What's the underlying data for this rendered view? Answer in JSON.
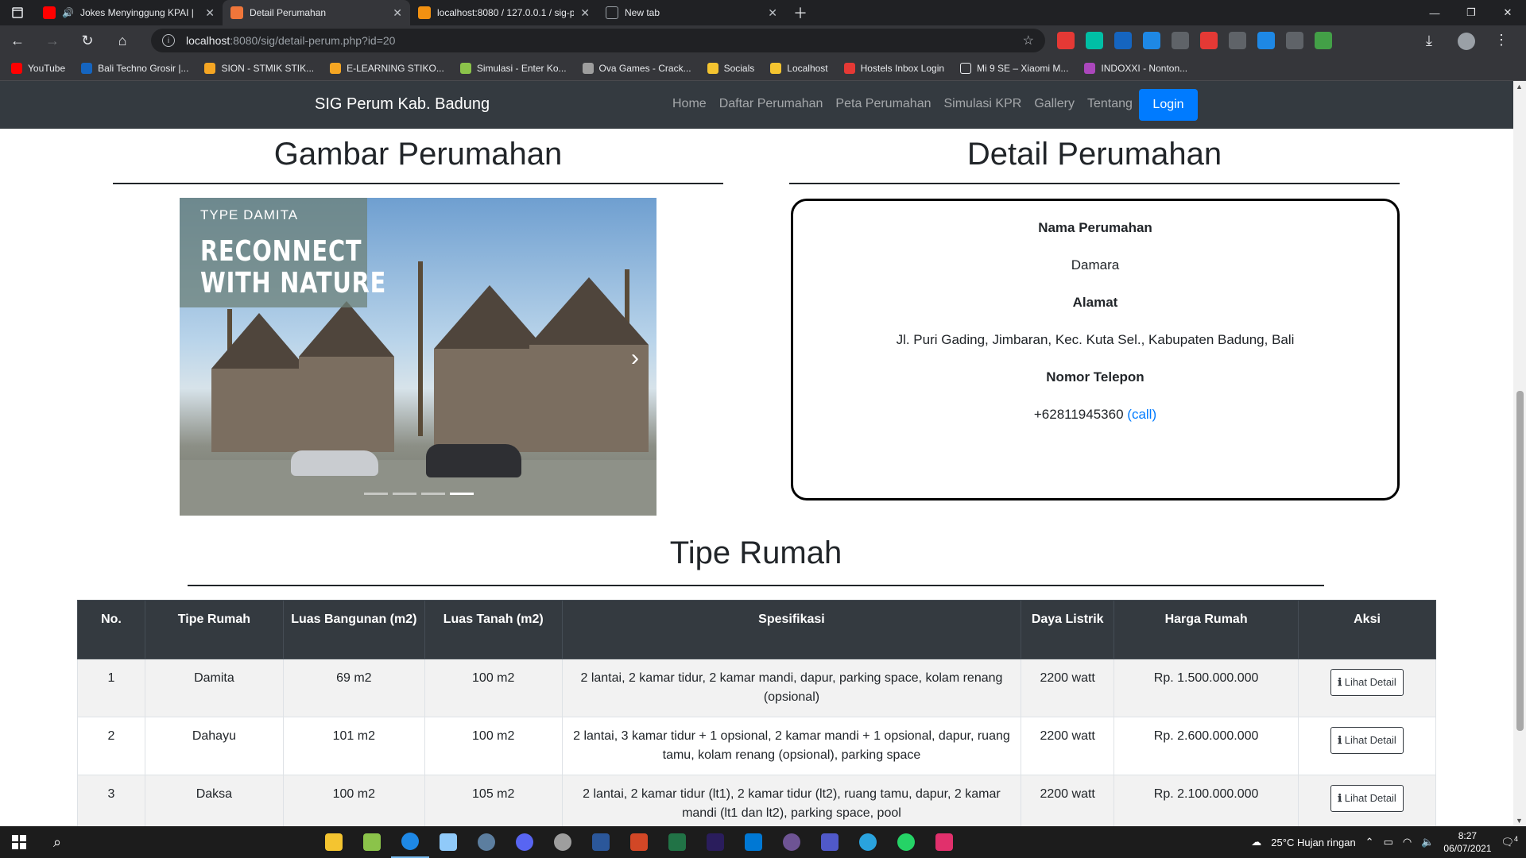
{
  "browser": {
    "tabs": [
      {
        "label": "Jokes Menyinggung KPAI | ",
        "favicon_color": "#ff0000",
        "active": false
      },
      {
        "label": "Detail Perumahan",
        "favicon_color": "#f0763a",
        "active": true
      },
      {
        "label": "localhost:8080 / 127.0.0.1 / sig-p",
        "favicon_color": "#f29111",
        "active": false
      },
      {
        "label": "New tab",
        "favicon_color": "#9aa0a6",
        "active": false
      }
    ],
    "url_host": "localhost",
    "url_path": ":8080/sig/detail-perum.php?id=20",
    "bookmarks": [
      {
        "label": "YouTube",
        "color": "#ff0000"
      },
      {
        "label": "Bali Techno Grosir |...",
        "color": "#1565c0"
      },
      {
        "label": "SION - STMIK STIK...",
        "color": "#f5a623"
      },
      {
        "label": "E-LEARNING STIKO...",
        "color": "#f5a623"
      },
      {
        "label": "Simulasi - Enter Ko...",
        "color": "#8bc34a"
      },
      {
        "label": "Ova Games - Crack...",
        "color": "#9e9e9e"
      },
      {
        "label": "Socials",
        "color": "#f4c430"
      },
      {
        "label": "Localhost",
        "color": "#f4c430"
      },
      {
        "label": "Hostels Inbox Login",
        "color": "#e53935"
      },
      {
        "label": "Mi 9 SE – Xiaomi M...",
        "color": "#e8eaed"
      },
      {
        "label": "INDOXXI - Nonton...",
        "color": "#ab47bc"
      }
    ]
  },
  "nav": {
    "brand": "SIG Perum Kab. Badung",
    "links": [
      "Home",
      "Daftar Perumahan",
      "Peta Perumahan",
      "Simulasi KPR",
      "Gallery",
      "Tentang"
    ],
    "login": "Login"
  },
  "gambar": {
    "title": "Gambar Perumahan",
    "overlay_small": "TYPE DAMITA",
    "overlay_line1": "RECONNECT",
    "overlay_line2": "WITH NATURE",
    "next_glyph": "›",
    "slide_count": 4,
    "active_slide": 4
  },
  "detail": {
    "title": "Detail Perumahan",
    "nama_label": "Nama Perumahan",
    "nama_value": "Damara",
    "alamat_label": "Alamat",
    "alamat_value": "Jl. Puri Gading, Jimbaran, Kec. Kuta Sel., Kabupaten Badung, Bali",
    "telepon_label": "Nomor Telepon",
    "telepon_value": "+62811945360",
    "call_text": "call"
  },
  "tipe": {
    "title": "Tipe Rumah",
    "headers": [
      "No.",
      "Tipe Rumah",
      "Luas Bangunan (m2)",
      "Luas Tanah (m2)",
      "Spesifikasi",
      "Daya Listrik",
      "Harga Rumah",
      "Aksi"
    ],
    "rows": [
      [
        "1",
        "Damita",
        "69 m2",
        "100 m2",
        "2 lantai, 2 kamar tidur, 2 kamar mandi, dapur, parking space, kolam renang (opsional)",
        "2200 watt",
        "Rp. 1.500.000.000",
        "Lihat Detail"
      ],
      [
        "2",
        "Dahayu",
        "101 m2",
        "100 m2",
        "2 lantai, 3 kamar tidur + 1 opsional, 2 kamar mandi + 1 opsional, dapur, ruang tamu, kolam renang (opsional), parking space",
        "2200 watt",
        "Rp. 2.600.000.000",
        "Lihat Detail"
      ],
      [
        "3",
        "Daksa",
        "100 m2",
        "105 m2",
        "2 lantai, 2 kamar tidur (lt1), 2 kamar tidur (lt2), ruang tamu, dapur, 2 kamar mandi (lt1 dan lt2), parking space, pool",
        "2200 watt",
        "Rp. 2.100.000.000",
        "Lihat Detail"
      ]
    ]
  },
  "taskbar": {
    "weather": "25°C  Hujan ringan",
    "time": "8:27",
    "date": "06/07/2021",
    "notif": "4"
  }
}
